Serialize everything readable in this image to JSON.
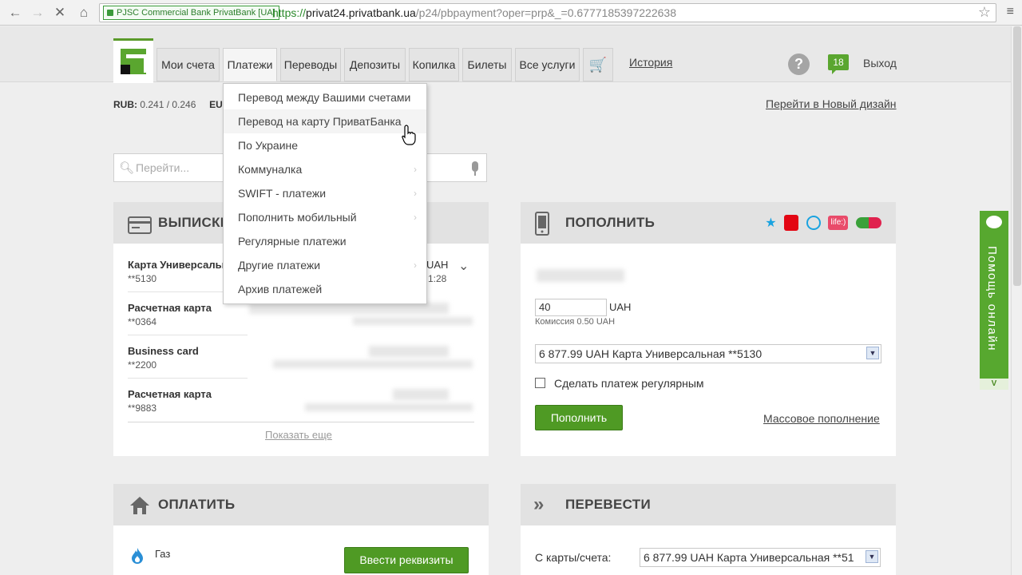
{
  "browser": {
    "ev_cert": "PJSC Commercial Bank PrivatBank [UA]",
    "url_scheme": "https://",
    "url_host": "privat24.privatbank.ua",
    "url_path": "/p24/pbpayment?oper=prp&_=0.6777185397222638"
  },
  "nav": {
    "tabs": [
      "Мои счета",
      "Платежи",
      "Переводы",
      "Депозиты",
      "Копилка",
      "Билеты",
      "Все услуги"
    ],
    "active_tab": "Платежи",
    "history": "История",
    "messages_count": "18",
    "logout": "Выход"
  },
  "rates": {
    "rub_label": "RUB:",
    "rub_value": "0.241 / 0.246",
    "eur_label": "EU"
  },
  "new_design_link": "Перейти в Новый дизайн",
  "search": {
    "placeholder": "Перейти..."
  },
  "dropdown": {
    "items": [
      "Перевод между Вашими счетами",
      "Перевод на карту ПриватБанка",
      "По Украине",
      "Коммуналка",
      "SWIFT - платежи",
      "Пополнить мобильный",
      "Регулярные платежи",
      "Другие платежи",
      "Архив платежей"
    ],
    "hovered": "Перевод на карту ПриватБанка"
  },
  "statements": {
    "title": "ВЫПИСКИ",
    "accounts": [
      {
        "name": "Карта Универсальная",
        "number": "**5130",
        "currency": "UAH",
        "time": "1:28"
      },
      {
        "name": "Расчетная карта",
        "number": "**0364"
      },
      {
        "name": "Business card",
        "number": "**2200"
      },
      {
        "name": "Расчетная карта",
        "number": "**9883"
      }
    ],
    "show_more": "Показать еще"
  },
  "topup": {
    "title": "ПОПОЛНИТЬ",
    "amount": "40",
    "currency": "UAH",
    "commission": "Комиссия 0.50 UAH",
    "card_select": "6 877.99 UAH   Карта Универсальная **5130",
    "regular_label": "Сделать платеж регулярным",
    "button": "Пополнить",
    "mass_link": "Массовое пополнение",
    "life_logo": "life:)"
  },
  "pay": {
    "title": "ОПЛАТИТЬ",
    "gas": "Газ",
    "button": "Ввести реквизиты"
  },
  "transfer": {
    "title": "ПЕРЕВЕСТИ",
    "from_label": "С карты/счета:",
    "card_select": "6 877.99 UAH   Карта Универсальная **51"
  },
  "help_online": {
    "label": "Помощь онлайн",
    "collapse": "V"
  },
  "colors": {
    "brand_green": "#5aa62f",
    "button_green": "#4f9a24"
  }
}
